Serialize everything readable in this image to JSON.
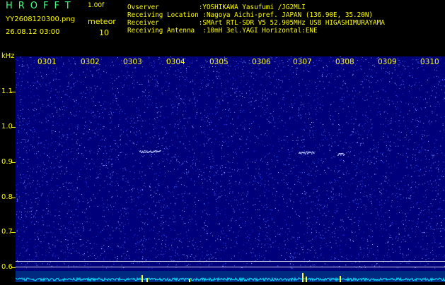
{
  "header": {
    "logo": "HROFFT",
    "version": "1.00f",
    "filename": "YY2608120300.png",
    "datetime": "26.08.12 03:00",
    "meteor_label": "meteor",
    "meteor_count": "10"
  },
  "info_lines": [
    "Ovserver          :YOSHIKAWA Yasufumi /JG2MLI",
    "Receiving Location :Nagoya Aichi-pref. JAPAN (136.90E, 35.20N)",
    "Receiver          :SMArt RTL-SDR V5 52.905MHz USB HIGASHIMURAYAMA",
    "Receiving Antenna  :10mH 3el.YAGI Horizontal:ENE"
  ],
  "axis": {
    "y_unit": "kHz",
    "y_labels": [
      "1.1",
      "1.0",
      "0.9",
      "0.8",
      "0.7",
      "0.6"
    ],
    "time_labels": [
      "0301",
      "0302",
      "0303",
      "0304",
      "0305",
      "0306",
      "0307",
      "0308",
      "0309",
      "0310"
    ]
  }
}
